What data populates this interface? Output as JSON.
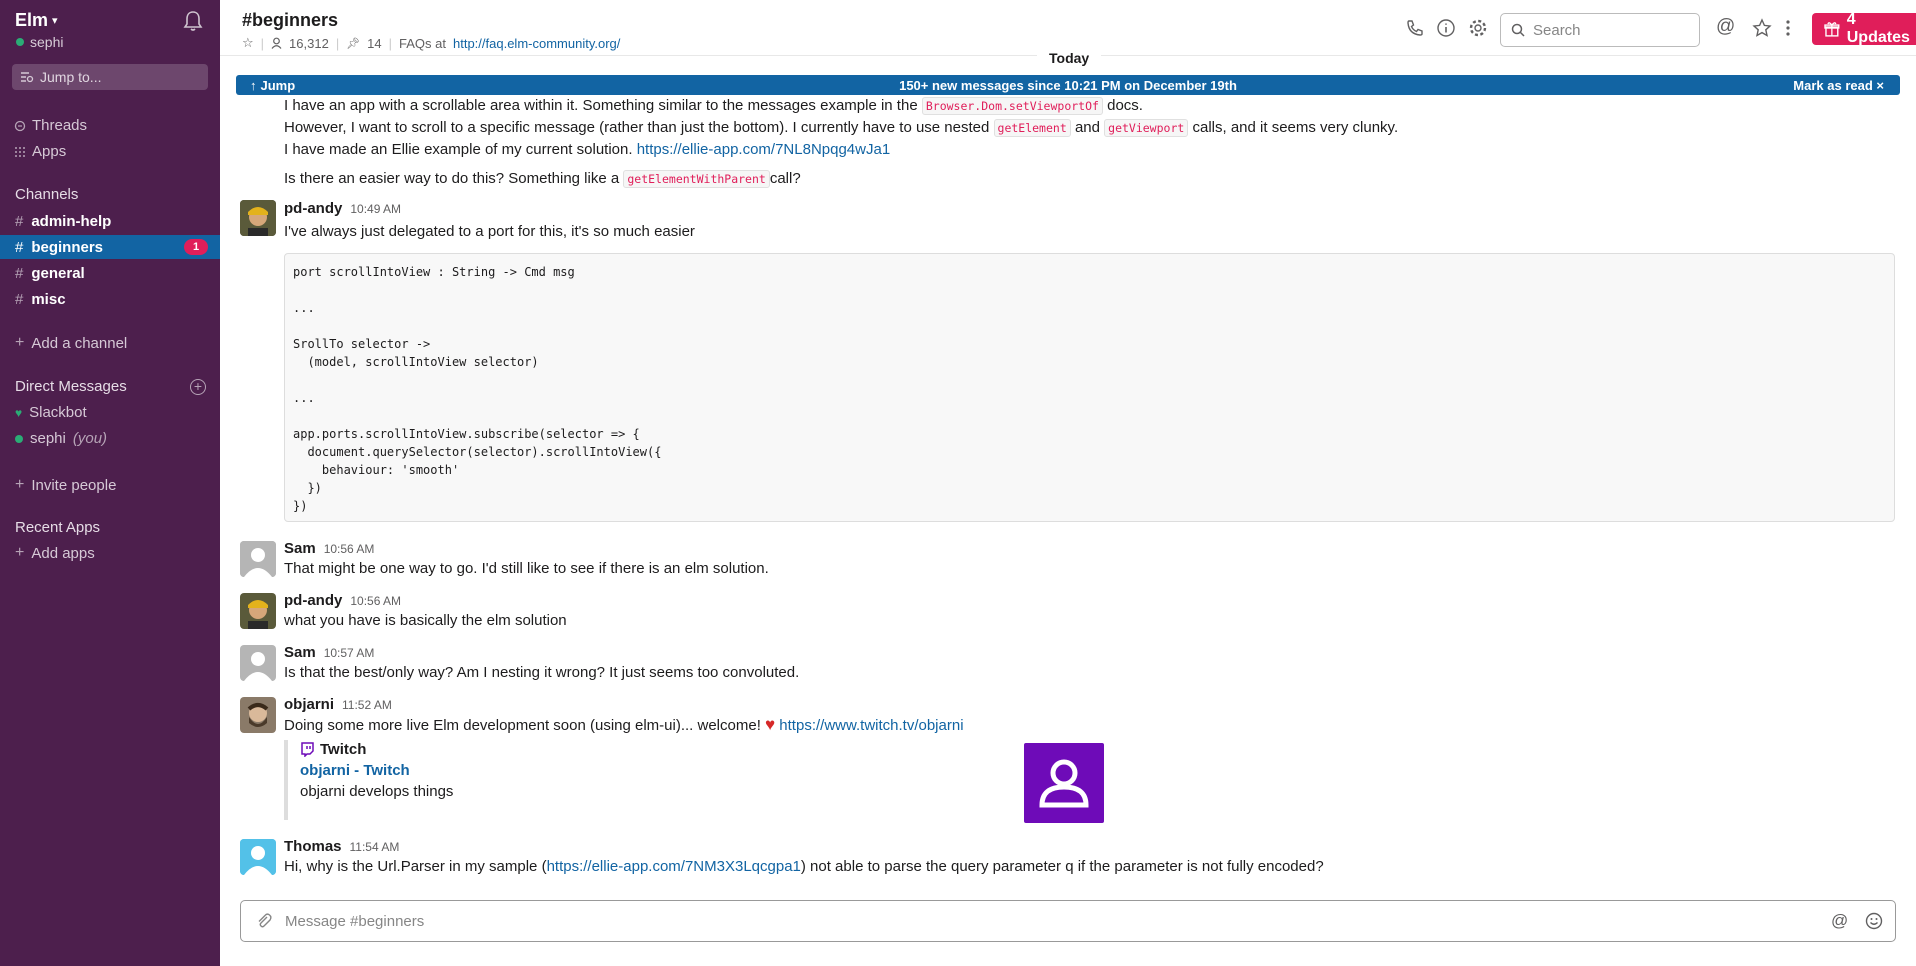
{
  "workspace": {
    "name": "Elm",
    "user": "sephi",
    "jump_placeholder": "Jump to..."
  },
  "sidebar": {
    "nav": [
      "Threads",
      "Apps"
    ],
    "channels_title": "Channels",
    "channels": [
      {
        "name": "admin-help"
      },
      {
        "name": "beginners",
        "badge": "1"
      },
      {
        "name": "general"
      },
      {
        "name": "misc"
      }
    ],
    "add_channel": "Add a channel",
    "dm_title": "Direct Messages",
    "dms": [
      {
        "name": "Slackbot"
      },
      {
        "name": "sephi",
        "suffix": "(you)"
      }
    ],
    "invite": "Invite people",
    "recent_apps_title": "Recent Apps",
    "add_apps": "Add apps"
  },
  "header": {
    "channel": "#beginners",
    "members": "16,312",
    "pins": "14",
    "faq_prefix": "FAQs at",
    "faq_link": "http://faq.elm-community.org/",
    "search_placeholder": "Search",
    "updates": "4 Updates"
  },
  "banner": {
    "today": "Today",
    "jump": "Jump",
    "text": "150+ new messages since 10:21 PM on December 19th",
    "mark": "Mark as read"
  },
  "messages": {
    "intro": {
      "l1a": "I have an app with a scrollable area within it. Something similar to the messages example in the",
      "l1code": "Browser.Dom.setViewportOf",
      "l1b": "docs.",
      "l2a": "However, I want to scroll to a specific message (rather than just the bottom). I currently have to use nested",
      "l2code1": "getElement",
      "l2mid": "and",
      "l2code2": "getViewport",
      "l2b": "calls, and it seems very clunky.",
      "l3a": "I have made an Ellie example of my current solution.",
      "l3link": "https://ellie-app.com/7NL8Npqg4wJa1",
      "l4a": "Is there an easier way to do this? Something like a",
      "l4code": "getElementWithParent",
      "l4b": "call?"
    },
    "m1": {
      "author": "pd-andy",
      "time": "10:49 AM",
      "text": "I've always just delegated to a port for this, it's so much easier",
      "code": "port scrollIntoView : String -> Cmd msg\n\n...\n\nSrollTo selector ->\n  (model, scrollIntoView selector)\n\n...\n\napp.ports.scrollIntoView.subscribe(selector => {\n  document.querySelector(selector).scrollIntoView({\n    behaviour: 'smooth'\n  })\n})"
    },
    "m2": {
      "author": "Sam",
      "time": "10:56 AM",
      "text": "That might be one way to go. I'd still like to see if there is an elm solution."
    },
    "m3": {
      "author": "pd-andy",
      "time": "10:56 AM",
      "text": "what you have is basically the elm solution"
    },
    "m4": {
      "author": "Sam",
      "time": "10:57 AM",
      "text": "Is that the best/only way? Am I nesting it wrong? It just seems too convoluted."
    },
    "m5": {
      "author": "objarni",
      "time": "11:52 AM",
      "text": "Doing some more live Elm development soon (using elm-ui)... welcome!",
      "link": "https://www.twitch.tv/objarni",
      "attach_service": "Twitch",
      "attach_title": "objarni - Twitch",
      "attach_desc": "objarni develops things"
    },
    "m6": {
      "author": "Thomas",
      "time": "11:54 AM",
      "text_a": "Hi, why is the Url.Parser in my sample (",
      "link": "https://ellie-app.com/7NM3X3Lqcgpa1",
      "text_b": ") not able to parse the query parameter q if the parameter is not fully encoded?"
    }
  },
  "composer": {
    "placeholder": "Message #beginners"
  },
  "colors": {
    "sidebar": "#4d1f4d",
    "active": "#1264a3",
    "badge": "#e01e5a",
    "twitch": "#6e0bb8"
  }
}
